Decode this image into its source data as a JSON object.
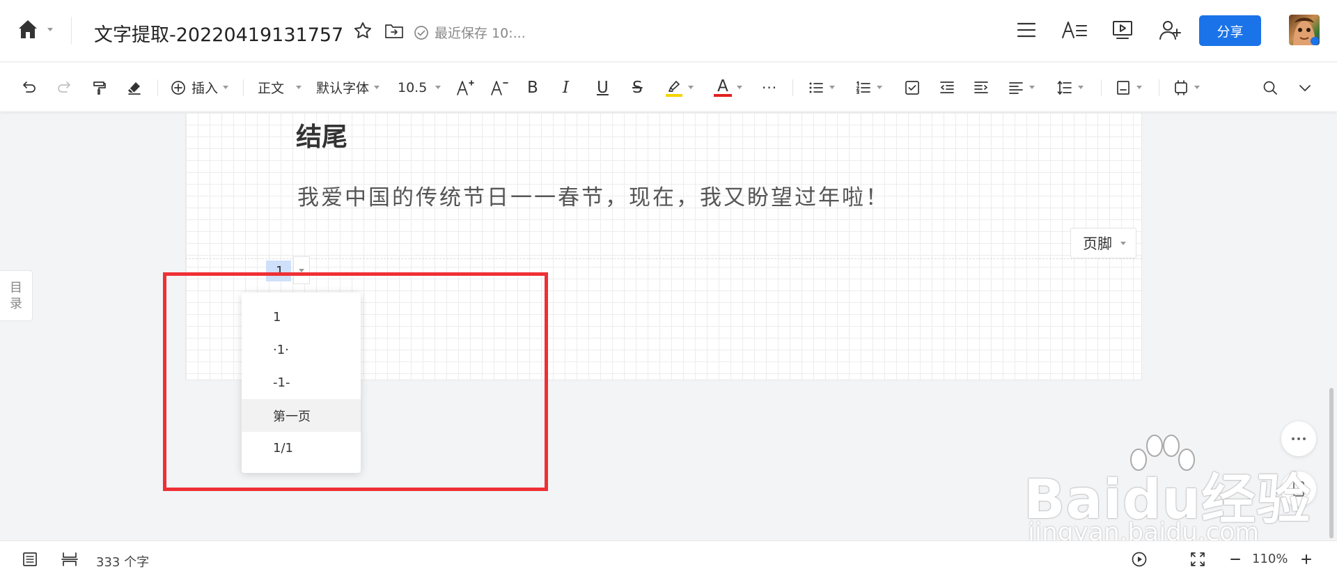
{
  "header": {
    "title": "文字提取-20220419131757",
    "save_status": "最近保存 10:...",
    "share_label": "分享"
  },
  "toolbar": {
    "insert_label": "插入",
    "style_value": "正文",
    "font_value": "默认字体",
    "size_value": "10.5",
    "bold": "B",
    "italic": "I",
    "underline": "U",
    "strike": "S",
    "font_color_glyph": "A",
    "more": "···",
    "highlight_color": "#f5d400",
    "font_color": "#e02020"
  },
  "document": {
    "heading": "结尾",
    "paragraph": "我爱中国的传统节日一一春节，现在，我又盼望过年啦！",
    "footer_label": "页脚",
    "page_number_value": "1"
  },
  "page_number_menu": {
    "options": [
      "1",
      "·1·",
      "-1-",
      "第一页",
      "1/1"
    ],
    "hovered_index": 3
  },
  "toc": {
    "label_top": "目",
    "label_bottom": "录"
  },
  "status": {
    "word_count": "333 个字",
    "zoom": "110%"
  },
  "watermark": {
    "brand": "Baidu经验",
    "url": "jingyan.baidu.com"
  },
  "colors": {
    "accent": "#1a73e8",
    "annotation": "#ee3035"
  }
}
